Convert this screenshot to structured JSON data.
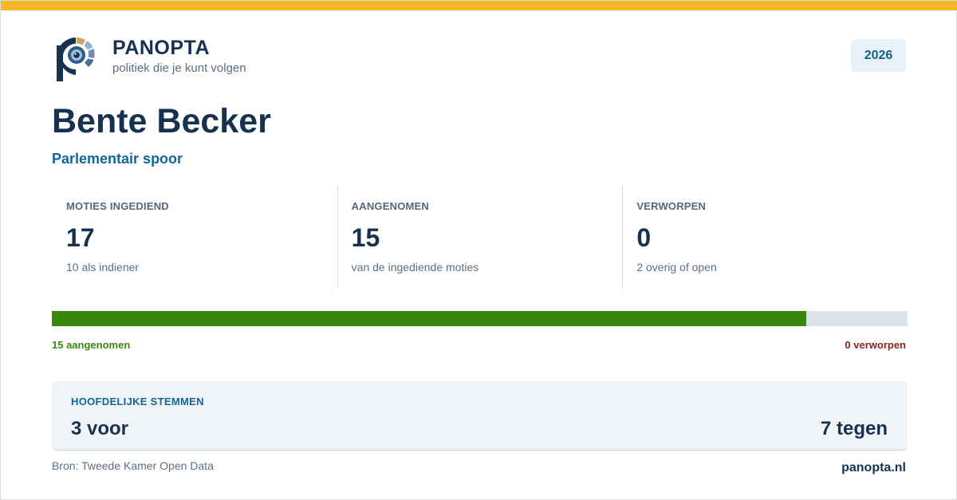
{
  "brand": {
    "name": "PANOPTA",
    "tagline": "politiek die je kunt volgen",
    "logo_icon": "eye-p-logo-icon"
  },
  "year": "2026",
  "person": {
    "name": "Bente Becker",
    "track": "Parlementair spoor"
  },
  "stats": [
    {
      "label": "MOTIES INGEDIEND",
      "value": "17",
      "sub": "10 als indiener"
    },
    {
      "label": "AANGENOMEN",
      "value": "15",
      "sub": "van de ingediende moties"
    },
    {
      "label": "VERWORPEN",
      "value": "0",
      "sub": "2 overig of open"
    }
  ],
  "progress": {
    "adopted_fraction": 0.882,
    "adopted_label": "15 aangenomen",
    "rejected_label": "0 verworpen"
  },
  "votes": {
    "title": "HOOFDELIJKE STEMMEN",
    "for": "3 voor",
    "against": "7 tegen"
  },
  "footer": {
    "source": "Bron: Tweede Kamer Open Data",
    "site": "panopta.nl"
  },
  "colors": {
    "accent_bar": "#f6b822",
    "navy": "#17324f",
    "blue": "#12659a",
    "adopted": "#3a870f",
    "rejected": "#8a231c"
  }
}
